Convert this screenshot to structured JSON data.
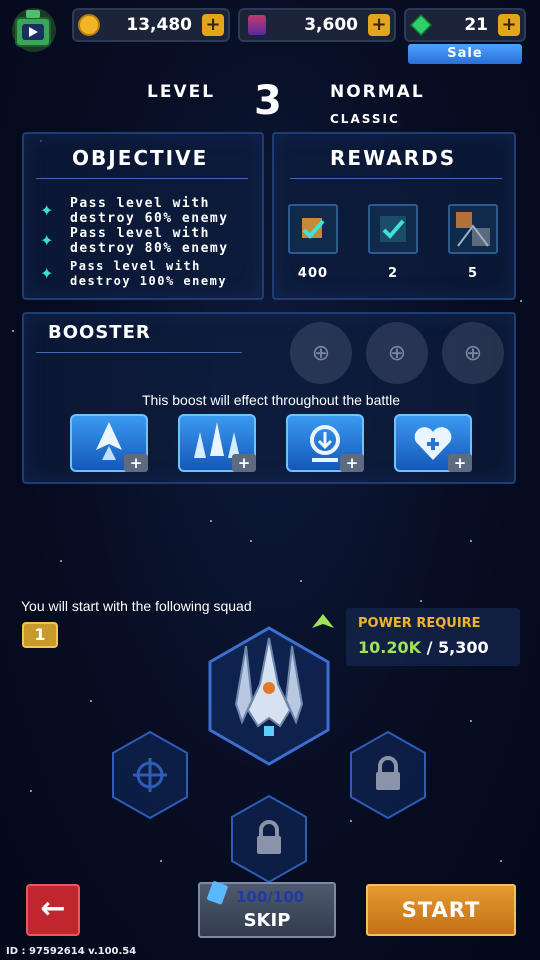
{
  "topbar": {
    "coins": "13,480",
    "gems": "3,600",
    "crystals": "21",
    "sale_label": "Sale"
  },
  "level": {
    "label": "LEVEL",
    "number": "3",
    "difficulty": "NORMAL",
    "mode": "CLASSIC"
  },
  "objective": {
    "title": "OBJECTIVE",
    "items": [
      "Pass level with\ndestroy 60% enemy",
      "Pass level with\ndestroy 80% enemy",
      "Pass level with\ndestroy 100% enemy"
    ]
  },
  "rewards": {
    "title": "REWARDS",
    "items": [
      {
        "value": "400"
      },
      {
        "value": "2"
      },
      {
        "value": "5"
      }
    ]
  },
  "booster": {
    "title": "BOOSTER",
    "description": "This boost will effect throughout the battle",
    "icons": [
      "speed-boost-icon",
      "squad-boost-icon",
      "shield-boost-icon",
      "heart-boost-icon"
    ]
  },
  "squad": {
    "text": "You will start with the following squad",
    "count": "1",
    "power_label": "POWER REQUIRE",
    "power_current": "10.20K",
    "power_required": "/ 5,300"
  },
  "actions": {
    "back_icon": "arrow-left-icon",
    "skip_energy": "100/100",
    "skip_label": "SKIP",
    "start_label": "START"
  },
  "footer": {
    "id_text": "ID : 97592614 v.100.54"
  },
  "colors": {
    "accent_gold": "#e3a51c",
    "power_green": "#9fe35a",
    "power_gold": "#f0b52c",
    "panel_border": "#1f3d73",
    "sale_blue": "#2f7fe0"
  }
}
